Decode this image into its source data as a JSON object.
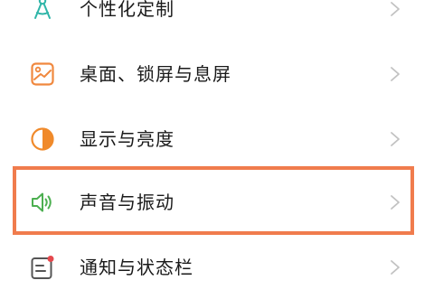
{
  "settings": {
    "items": [
      {
        "label": "个性化定制",
        "icon": "personalize-icon",
        "color": "#2fb5a8"
      },
      {
        "label": "桌面、锁屏与息屏",
        "icon": "wallpaper-icon",
        "color": "#f0883e"
      },
      {
        "label": "显示与亮度",
        "icon": "brightness-icon",
        "color": "#f08a2b"
      },
      {
        "label": "声音与振动",
        "icon": "speaker-icon",
        "color": "#4caf50"
      },
      {
        "label": "通知与状态栏",
        "icon": "notification-icon",
        "color": "#555555"
      }
    ],
    "highlight_color": "#f07c4d"
  }
}
